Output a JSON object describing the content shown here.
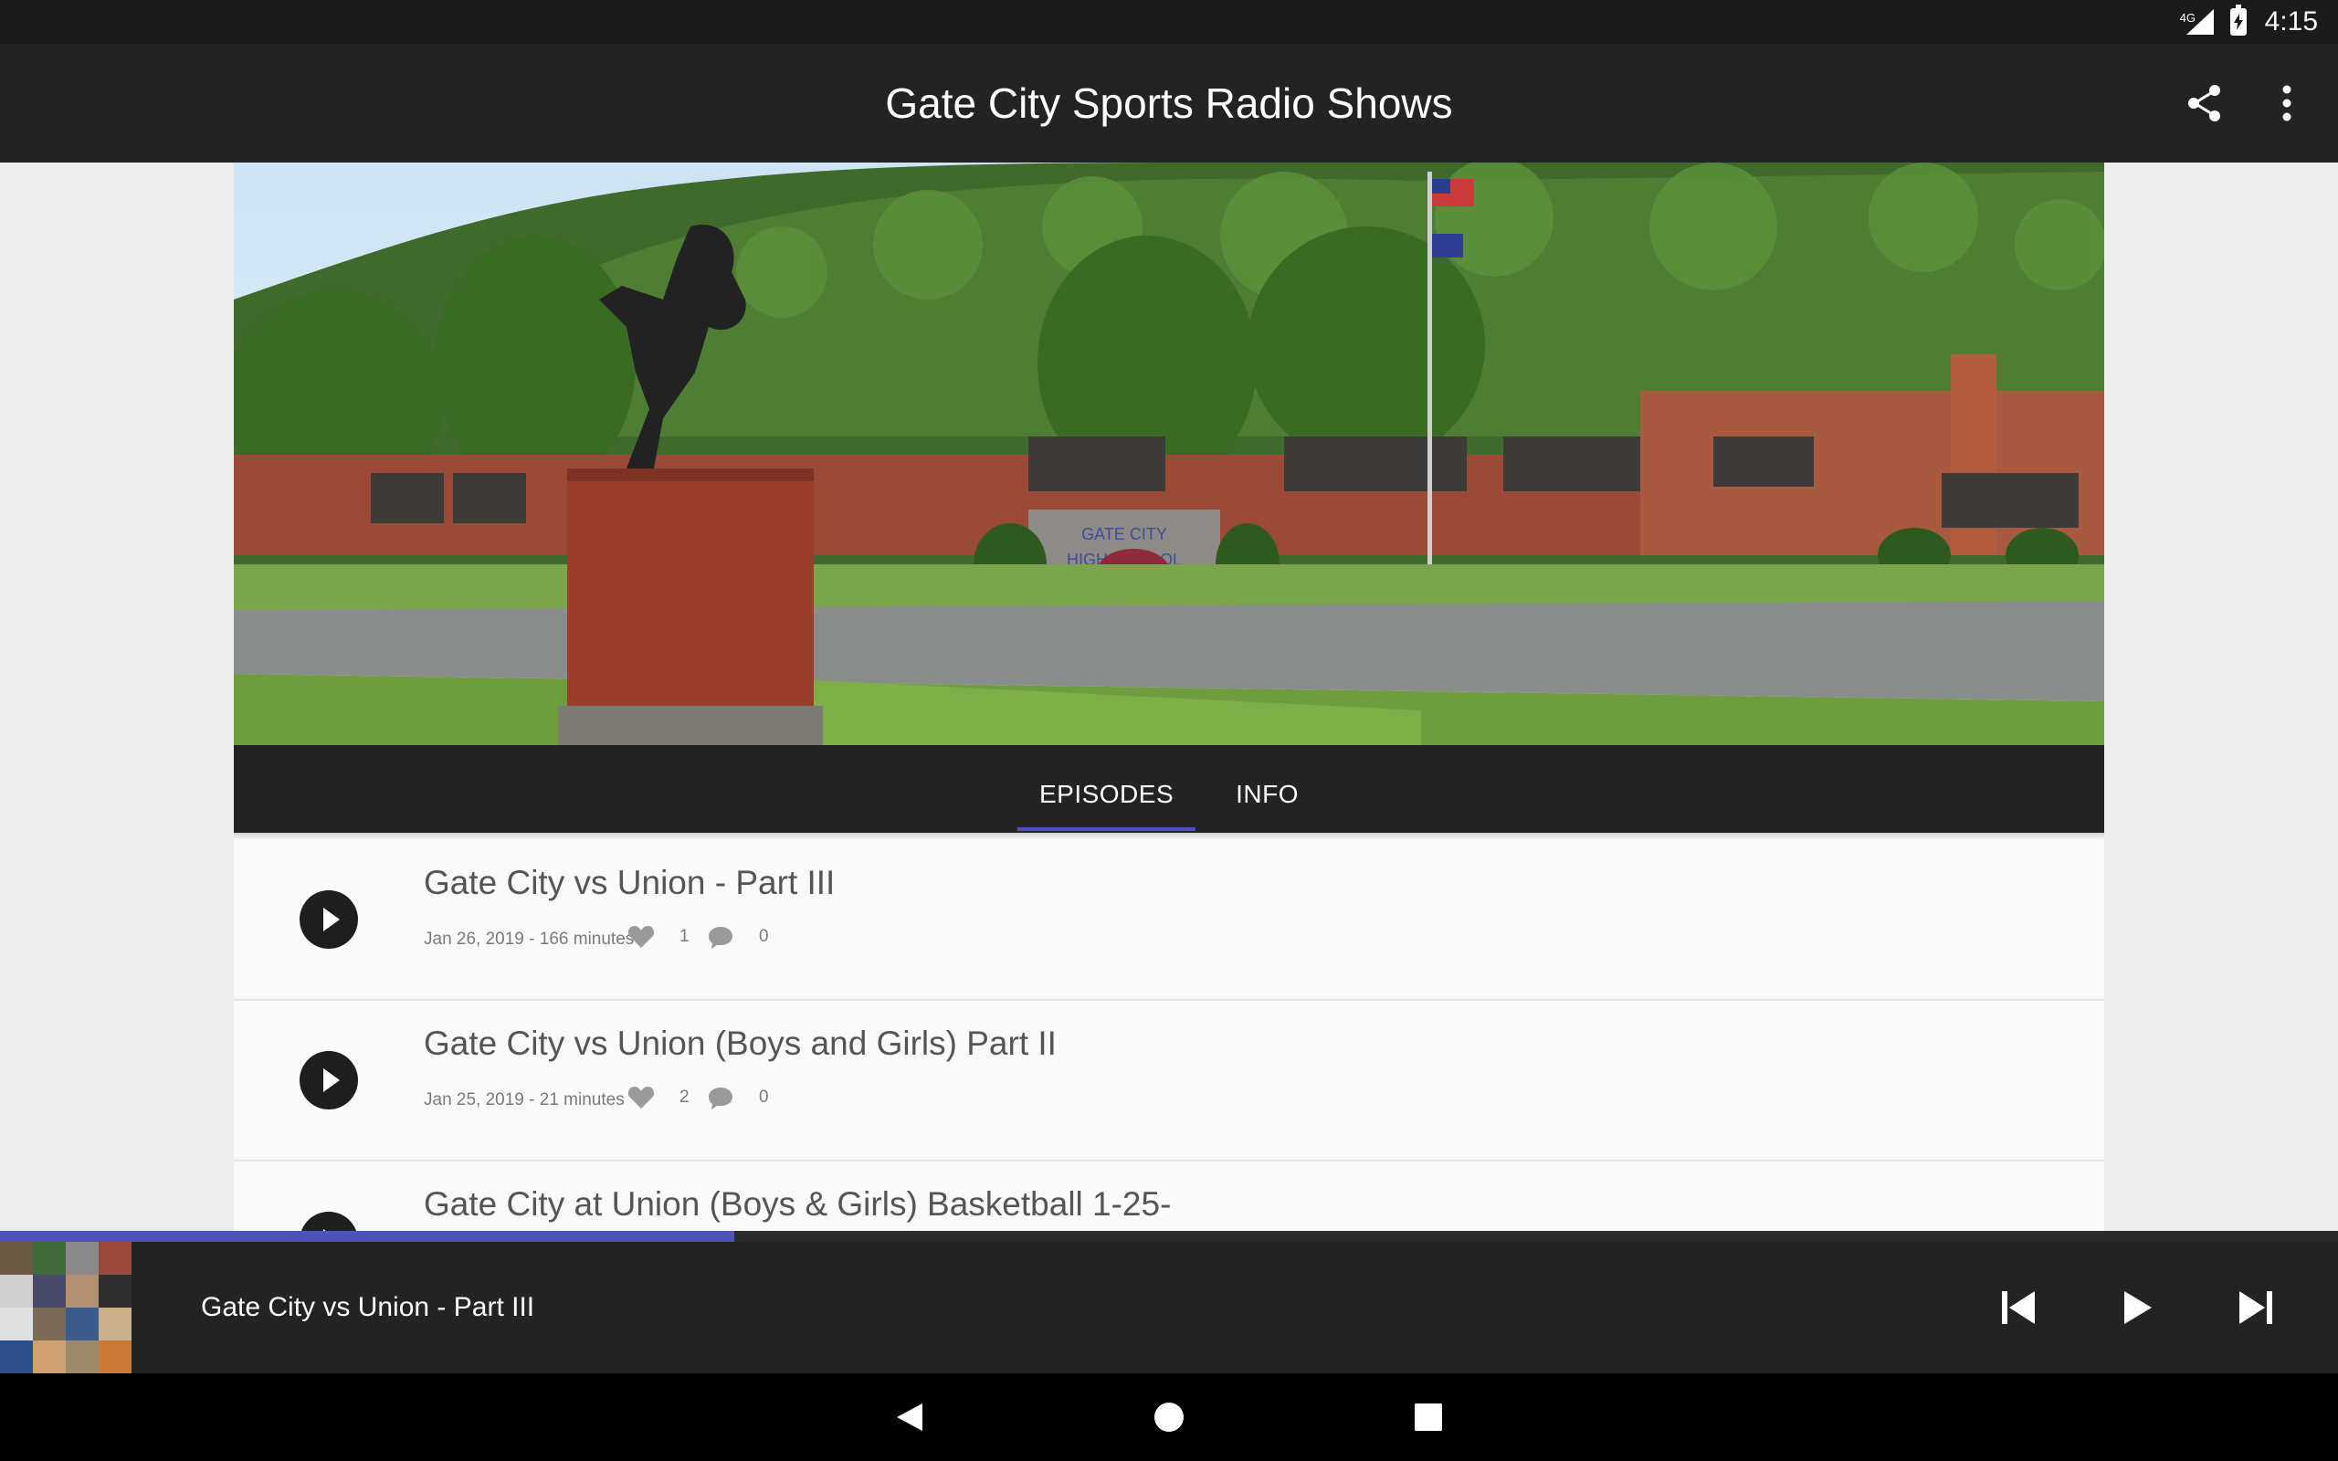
{
  "status_bar": {
    "network": "4G",
    "time": "4:15"
  },
  "app_bar": {
    "title": "Gate City Sports Radio Shows",
    "icons": [
      "share-icon",
      "more-vert-icon"
    ]
  },
  "hero": {
    "sign_line1": "GATE CITY",
    "sign_line2": "HIGH SCHOOL"
  },
  "tabs": [
    {
      "label": "EPISODES",
      "active": true
    },
    {
      "label": "INFO",
      "active": false
    }
  ],
  "episodes": [
    {
      "title": "Gate City vs Union - Part III",
      "meta": "Jan 26, 2019 - 166 minutes",
      "likes": "1",
      "comments": "0"
    },
    {
      "title": "Gate City vs Union (Boys and Girls) Part II",
      "meta": "Jan 25, 2019 - 21 minutes",
      "likes": "2",
      "comments": "0"
    },
    {
      "title": "Gate City at Union (Boys & Girls) Basketball 1-25-",
      "meta": "",
      "likes": "",
      "comments": ""
    }
  ],
  "player": {
    "now_playing": "Gate City vs Union - Part III",
    "progress": 0.314,
    "icons": [
      "skip-previous-icon",
      "play-icon",
      "skip-next-icon"
    ]
  },
  "colors": {
    "accent": "#4f52b8",
    "bar": "#232323",
    "status": "#1b1b1b"
  }
}
